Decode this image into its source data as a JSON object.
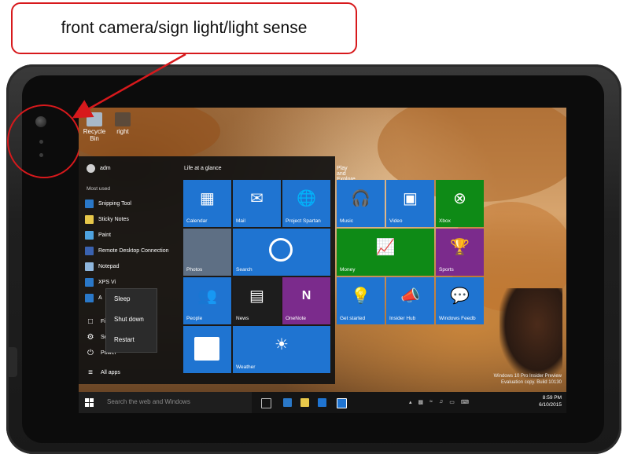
{
  "callout": {
    "text": "front camera/sign light/light sense"
  },
  "desktop": {
    "icons": [
      {
        "label": "Recycle Bin"
      },
      {
        "label": "right"
      }
    ],
    "watermark": [
      "Windows 10 Pro Insider Preview",
      "Evaluation copy. Build 10130"
    ]
  },
  "start_menu": {
    "user": "adm",
    "most_used_label": "Most used",
    "apps": [
      {
        "label": "Snipping Tool"
      },
      {
        "label": "Sticky Notes"
      },
      {
        "label": "Paint"
      },
      {
        "label": "Remote Desktop Connection"
      },
      {
        "label": "Notepad"
      },
      {
        "label": "XPS Vi"
      },
      {
        "label": "A"
      }
    ],
    "bottom": {
      "file_explorer": "Fil",
      "settings": "Se",
      "power": "Power",
      "all_apps": "All apps"
    },
    "power_menu": [
      "Sleep",
      "Shut down",
      "Restart"
    ],
    "groups": [
      "Life at a glance",
      "Play and Explore"
    ],
    "tiles": {
      "calendar": "Calendar",
      "mail": "Mail",
      "spartan": "Project Spartan",
      "photos": "Photos",
      "search": "Search",
      "people": "People",
      "news": "News",
      "onenote": "OneNote",
      "store": "",
      "weather": "Weather",
      "music": "Music",
      "video": "Video",
      "xbox": "Xbox",
      "money": "Money",
      "sports": "Sports",
      "get_started": "Get started",
      "insider_hub": "Insider Hub",
      "feedback": "Windows Feedb"
    }
  },
  "taskbar": {
    "search_placeholder": "Search the web and Windows",
    "time": "8:59 PM",
    "date": "6/10/2015"
  },
  "colors": {
    "tile_blue": "#1f74d1",
    "tile_green": "#0e8a16",
    "tile_purple": "#7b2b8c",
    "callout_red": "#d7191c"
  }
}
